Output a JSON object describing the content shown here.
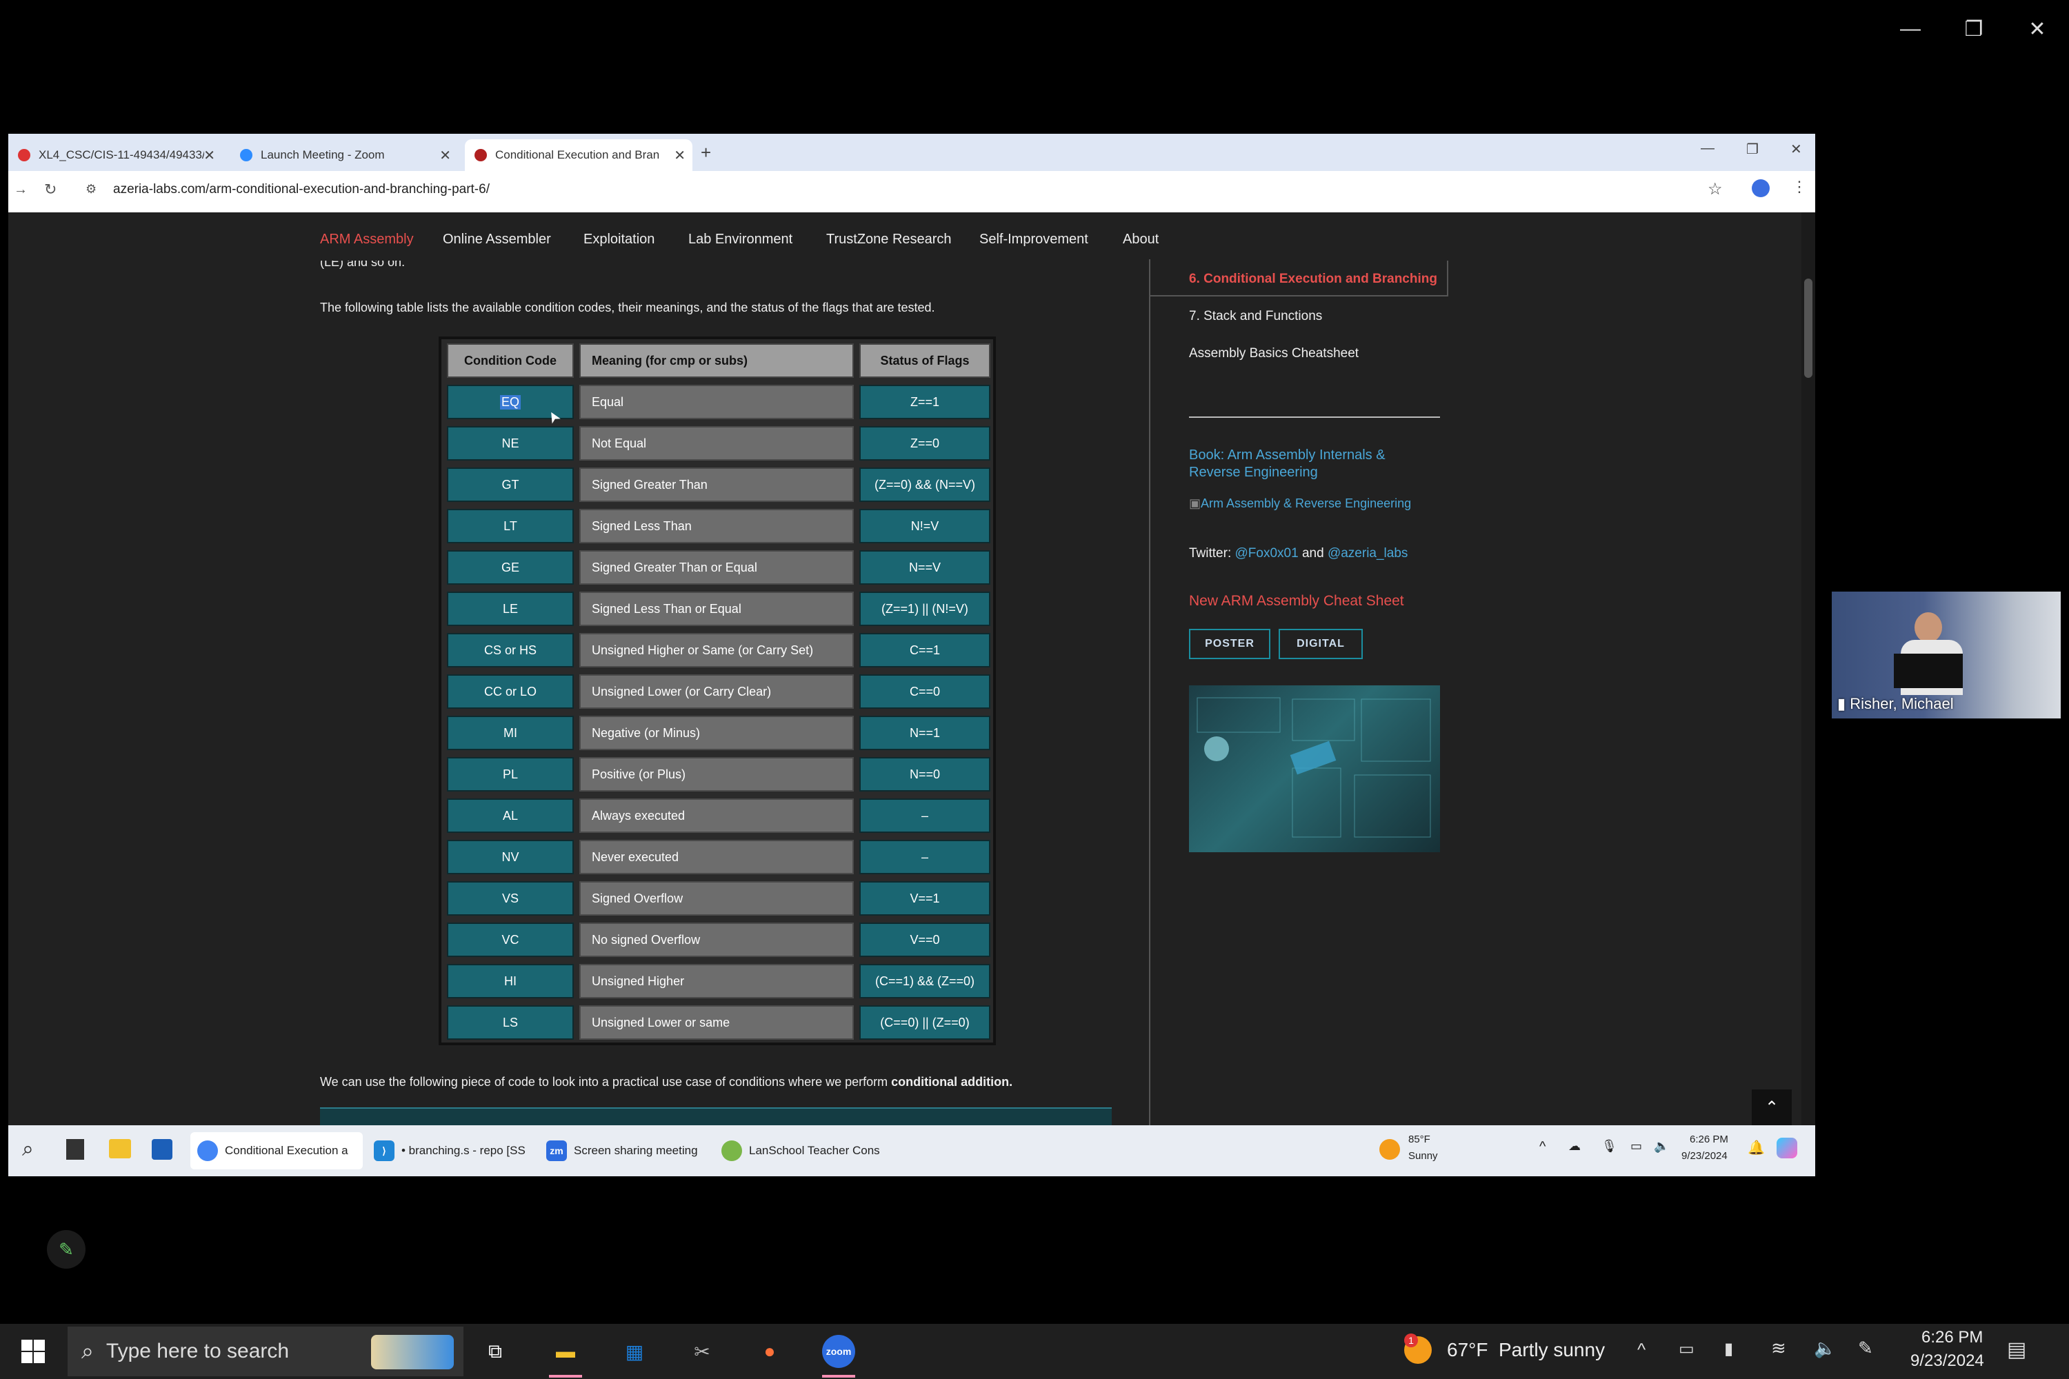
{
  "inner_browser": {
    "tabs": [
      {
        "title": "XL4_CSC/CIS-11-49434/49433/",
        "favicon_color": "#d33"
      },
      {
        "title": "Launch Meeting - Zoom",
        "favicon_color": "#2d8cff"
      },
      {
        "title": "Conditional Execution and Bran",
        "favicon_color": "#b02020"
      }
    ],
    "new_tab": "+",
    "url": "azeria-labs.com/arm-conditional-execution-and-branching-part-6/"
  },
  "site_nav": [
    "ARM Assembly",
    "Online Assembler",
    "Exploitation",
    "Lab Environment",
    "TrustZone Research",
    "Self-Improvement",
    "About"
  ],
  "cut_text": "(LE) and so on.",
  "intro": "The following table lists the available condition codes, their meanings, and the status of the flags that are tested.",
  "table": {
    "headers": [
      "Condition Code",
      "Meaning (for cmp or subs)",
      "Status of Flags"
    ],
    "rows": [
      [
        "EQ",
        "Equal",
        "Z==1"
      ],
      [
        "NE",
        "Not Equal",
        "Z==0"
      ],
      [
        "GT",
        "Signed Greater Than",
        "(Z==0) && (N==V)"
      ],
      [
        "LT",
        "Signed Less Than",
        "N!=V"
      ],
      [
        "GE",
        "Signed Greater Than or Equal",
        "N==V"
      ],
      [
        "LE",
        "Signed Less Than or Equal",
        "(Z==1) || (N!=V)"
      ],
      [
        "CS or HS",
        "Unsigned Higher or Same (or Carry Set)",
        "C==1"
      ],
      [
        "CC or LO",
        "Unsigned Lower (or Carry Clear)",
        "C==0"
      ],
      [
        "MI",
        "Negative (or Minus)",
        "N==1"
      ],
      [
        "PL",
        "Positive (or Plus)",
        "N==0"
      ],
      [
        "AL",
        "Always executed",
        "–"
      ],
      [
        "NV",
        "Never executed",
        "–"
      ],
      [
        "VS",
        "Signed Overflow",
        "V==1"
      ],
      [
        "VC",
        "No signed Overflow",
        "V==0"
      ],
      [
        "HI",
        "Unsigned Higher",
        "(C==1) && (Z==0)"
      ],
      [
        "LS",
        "Unsigned Lower or same",
        "(C==0) || (Z==0)"
      ]
    ]
  },
  "outro_prefix": "We can use the following piece of code to look into a practical use case of conditions where we perform ",
  "outro_bold": "conditional addition.",
  "sidebar": {
    "current": "6. Conditional Execution and Branching",
    "next": "7. Stack and Functions",
    "cheatsheet": "Assembly Basics Cheatsheet",
    "book_title": "Book: Arm Assembly Internals & Reverse Engineering",
    "book_img_alt": "Arm Assembly & Reverse Engineering",
    "twitter_label": "Twitter:",
    "twitter_1": "@Fox0x01",
    "twitter_and": "and",
    "twitter_2": "@azeria_labs",
    "cheat_title": "New ARM Assembly Cheat Sheet",
    "btn_poster": "POSTER",
    "btn_digital": "DIGITAL"
  },
  "inner_taskbar": {
    "apps": [
      {
        "label": "Conditional Execution a"
      },
      {
        "label": "• branching.s - repo [SS"
      },
      {
        "label": "Screen sharing meeting"
      },
      {
        "label": "LanSchool Teacher Cons"
      }
    ],
    "weather_temp": "85°F",
    "weather_desc": "Sunny",
    "time": "6:26 PM",
    "date": "9/23/2024"
  },
  "participant": "Risher, Michael",
  "outer_taskbar": {
    "search_placeholder": "Type here to search",
    "weather_badge": "1",
    "weather": "67°F  Partly sunny",
    "time": "6:26 PM",
    "date": "9/23/2024"
  },
  "colors": {
    "accent_red": "#e8504e",
    "teal": "#1a6672",
    "link_blue": "#4aa7d8"
  }
}
